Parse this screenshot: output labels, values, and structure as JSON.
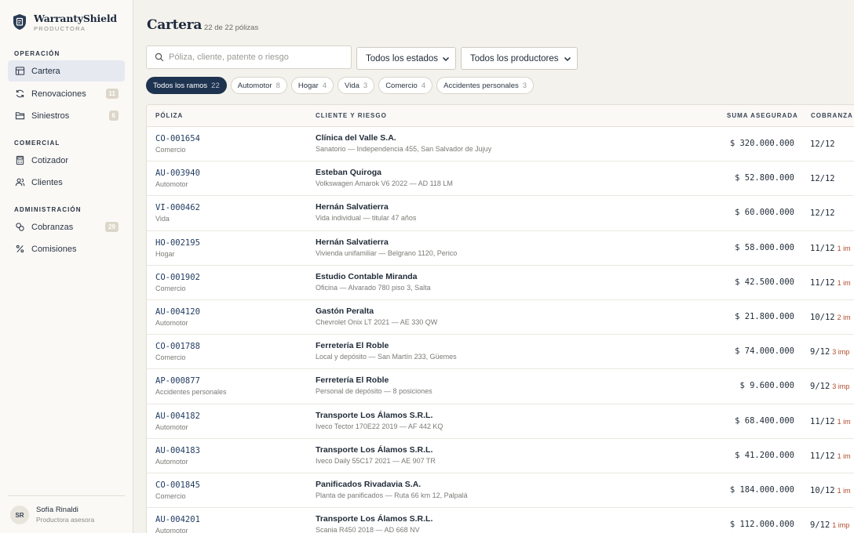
{
  "brand": {
    "name": "WarrantyShield",
    "subtitle": "PRODUCTORA"
  },
  "nav": {
    "sections": [
      {
        "title": "OPERACIÓN"
      },
      {
        "title": "COMERCIAL"
      },
      {
        "title": "ADMINISTRACIÓN"
      }
    ],
    "items": [
      {
        "label": "Cartera",
        "icon": "table-icon",
        "active": true
      },
      {
        "label": "Renovaciones",
        "icon": "refresh-icon",
        "badge": "11"
      },
      {
        "label": "Siniestros",
        "icon": "folder-icon",
        "badge": "6"
      },
      {
        "label": "Cotizador",
        "icon": "calculator-icon"
      },
      {
        "label": "Clientes",
        "icon": "users-icon"
      },
      {
        "label": "Cobranzas",
        "icon": "coins-icon",
        "badge": "29"
      },
      {
        "label": "Comisiones",
        "icon": "percent-icon"
      }
    ]
  },
  "user": {
    "initials": "SR",
    "name": "Sofía Rinaldi",
    "role": "Productora asesora"
  },
  "page": {
    "title": "Cartera",
    "count": "22 de 22 pólizas"
  },
  "filters": {
    "search_placeholder": "Póliza, cliente, patente o riesgo",
    "estado": "Todos los estados",
    "productor": "Todos los productores",
    "chips": [
      {
        "label": "Todos los ramos",
        "count": "22",
        "active": true
      },
      {
        "label": "Automotor",
        "count": "8"
      },
      {
        "label": "Hogar",
        "count": "4"
      },
      {
        "label": "Vida",
        "count": "3"
      },
      {
        "label": "Comercio",
        "count": "4"
      },
      {
        "label": "Accidentes personales",
        "count": "3"
      }
    ]
  },
  "table": {
    "headers": {
      "poliza": "PÓLIZA",
      "cliente": "CLIENTE Y RIESGO",
      "suma": "SUMA ASEGURADA",
      "cobranza": "COBRANZA"
    },
    "rows": [
      {
        "poliza": "CO-001654",
        "ramo": "Comercio",
        "cliente": "Clínica del Valle S.A.",
        "riesgo": "Sanatorio — Independencia 455, San Salvador de Jujuy",
        "suma": "$ 320.000.000",
        "cobranza": "12/12",
        "impagas": ""
      },
      {
        "poliza": "AU-003940",
        "ramo": "Automotor",
        "cliente": "Esteban Quiroga",
        "riesgo": "Volkswagen Amarok V6 2022 — AD 118 LM",
        "suma": "$ 52.800.000",
        "cobranza": "12/12",
        "impagas": ""
      },
      {
        "poliza": "VI-000462",
        "ramo": "Vida",
        "cliente": "Hernán Salvatierra",
        "riesgo": "Vida individual — titular 47 años",
        "suma": "$ 60.000.000",
        "cobranza": "12/12",
        "impagas": ""
      },
      {
        "poliza": "HO-002195",
        "ramo": "Hogar",
        "cliente": "Hernán Salvatierra",
        "riesgo": "Vivienda unifamiliar — Belgrano 1120, Perico",
        "suma": "$ 58.000.000",
        "cobranza": "11/12",
        "impagas": "1 im"
      },
      {
        "poliza": "CO-001902",
        "ramo": "Comercio",
        "cliente": "Estudio Contable Miranda",
        "riesgo": "Oficina — Alvarado 780 piso 3, Salta",
        "suma": "$ 42.500.000",
        "cobranza": "11/12",
        "impagas": "1 im"
      },
      {
        "poliza": "AU-004120",
        "ramo": "Automotor",
        "cliente": "Gastón Peralta",
        "riesgo": "Chevrolet Onix LT 2021 — AE 330 QW",
        "suma": "$ 21.800.000",
        "cobranza": "10/12",
        "impagas": "2 im"
      },
      {
        "poliza": "CO-001788",
        "ramo": "Comercio",
        "cliente": "Ferretería El Roble",
        "riesgo": "Local y depósito — San Martín 233, Güemes",
        "suma": "$ 74.000.000",
        "cobranza": "9/12",
        "impagas": "3 imp"
      },
      {
        "poliza": "AP-000877",
        "ramo": "Accidentes personales",
        "cliente": "Ferretería El Roble",
        "riesgo": "Personal de depósito — 8 posiciones",
        "suma": "$ 9.600.000",
        "cobranza": "9/12",
        "impagas": "3 imp"
      },
      {
        "poliza": "AU-004182",
        "ramo": "Automotor",
        "cliente": "Transporte Los Álamos S.R.L.",
        "riesgo": "Iveco Tector 170E22 2019 — AF 442 KQ",
        "suma": "$ 68.400.000",
        "cobranza": "11/12",
        "impagas": "1 im"
      },
      {
        "poliza": "AU-004183",
        "ramo": "Automotor",
        "cliente": "Transporte Los Álamos S.R.L.",
        "riesgo": "Iveco Daily 55C17 2021 — AE 907 TR",
        "suma": "$ 41.200.000",
        "cobranza": "11/12",
        "impagas": "1 im"
      },
      {
        "poliza": "CO-001845",
        "ramo": "Comercio",
        "cliente": "Panificados Rivadavia S.A.",
        "riesgo": "Planta de panificados — Ruta 66 km 12, Palpalá",
        "suma": "$ 184.000.000",
        "cobranza": "10/12",
        "impagas": "1 im"
      },
      {
        "poliza": "AU-004201",
        "ramo": "Automotor",
        "cliente": "Transporte Los Álamos S.R.L.",
        "riesgo": "Scania R450 2018 — AD 668 NV",
        "suma": "$ 112.000.000",
        "cobranza": "9/12",
        "impagas": "1 imp"
      }
    ]
  }
}
